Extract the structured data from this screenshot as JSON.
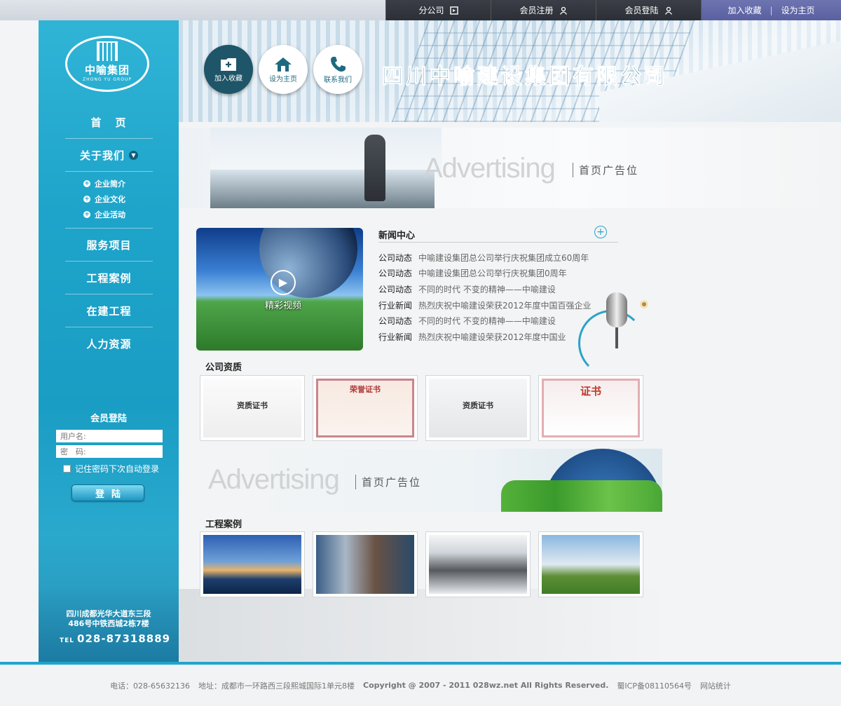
{
  "topnav": {
    "branch": "分公司",
    "register": "会员注册",
    "login": "会员登陆",
    "add_favorite": "加入收藏",
    "set_home": "设为主页"
  },
  "header": {
    "company_name": "四川中喻建设集团有限公司",
    "buttons": [
      {
        "label": "加入收藏",
        "icon": "bookmark-add-icon"
      },
      {
        "label": "设为主页",
        "icon": "home-icon"
      },
      {
        "label": "联系我们",
        "icon": "phone-icon"
      }
    ]
  },
  "logo": {
    "name": "中喻集团",
    "subtitle": "ZHONG YU GROUP"
  },
  "sidebar": {
    "menu": [
      {
        "label": "首页"
      },
      {
        "label": "关于我们"
      },
      {
        "label": "服务项目"
      },
      {
        "label": "工程案例"
      },
      {
        "label": "在建工程"
      },
      {
        "label": "人力资源"
      }
    ],
    "about_subs": [
      "企业简介",
      "企业文化",
      "企业活动"
    ],
    "login_title": "会员登陆",
    "username_placeholder": "用户名:",
    "password_placeholder": "密　码:",
    "remember": "记住密码下次自动登录",
    "login_button": "登陆",
    "address_line1": "四川成都光华大道东三段",
    "address_line2": "486号中铁西城2栋7楼",
    "tel_prefix": "TEL",
    "tel": "028-87318889"
  },
  "ads": {
    "word": "Advertising",
    "label": "首页广告位"
  },
  "video": {
    "label": "精彩视频"
  },
  "news": {
    "title": "新闻中心",
    "items": [
      {
        "category": "公司动态",
        "title": "中喻建设集团总公司举行庆祝集团成立60周年"
      },
      {
        "category": "公司动态",
        "title": "中喻建设集团总公司举行庆祝集团0周年"
      },
      {
        "category": "公司动态",
        "title": "不同的时代 不变的精神——中喻建设"
      },
      {
        "category": "行业新闻",
        "title": "热烈庆祝中喻建设荣获2012年度中国百强企业"
      },
      {
        "category": "公司动态",
        "title": "不同的时代 不变的精神——中喻建设"
      },
      {
        "category": "行业新闻",
        "title": "热烈庆祝中喻建设荣获2012年度中国业"
      }
    ]
  },
  "qualifications": {
    "title": "公司资质",
    "certs": [
      "资质证书",
      "荣誉证书",
      "资质证书",
      "证书"
    ]
  },
  "cases": {
    "title": "工程案例"
  },
  "footer": {
    "phone": "电话：028-65632136",
    "address": "地址：成都市一环路西三段熙城国际1单元8楼",
    "copyright": "Copyright @ 2007 - 2011 028wz.net All Rights Reserved.",
    "icp": "蜀ICP备08110564号",
    "stats": "网站统计"
  },
  "colors": {
    "accent": "#1fa6cc",
    "dark": "#2c2f36",
    "fav_bar": "#5a60a0"
  }
}
